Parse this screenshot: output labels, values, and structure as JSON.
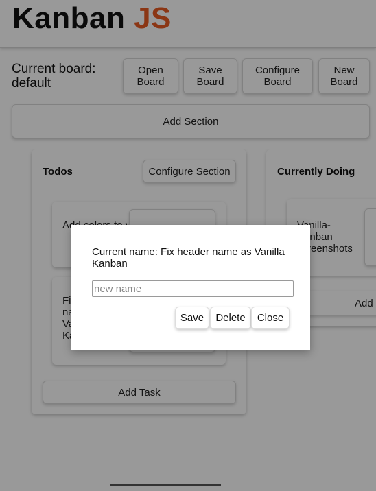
{
  "header": {
    "logo_main": "Kanban ",
    "logo_accent": "JS",
    "accent_color": "#e85a22"
  },
  "toolbar": {
    "board_label": "Current board: default",
    "open_board": "Open\nBoard",
    "save_board": "Save\nBoard",
    "configure_board": "Configure\nBoard",
    "new_board": "New\nBoard",
    "add_section": "Add Section"
  },
  "sections": [
    {
      "title": "Todos",
      "configure_label": "Configure Section",
      "tasks": [
        {
          "text": "Add colors to va"
        },
        {
          "text": "Fix\nna\nVa\nKa"
        }
      ],
      "add_task_label": "Add Task"
    },
    {
      "title": "Currently Doing",
      "tasks": [
        {
          "text": "Vanilla-\nKanban\nscreenshots"
        }
      ],
      "add_task_label": "Add"
    }
  ],
  "modal": {
    "message": "Current name: Fix header name as Vanilla Kanban",
    "input_placeholder": "new name",
    "input_value": "",
    "save_label": "Save",
    "delete_label": "Delete",
    "close_label": "Close"
  }
}
